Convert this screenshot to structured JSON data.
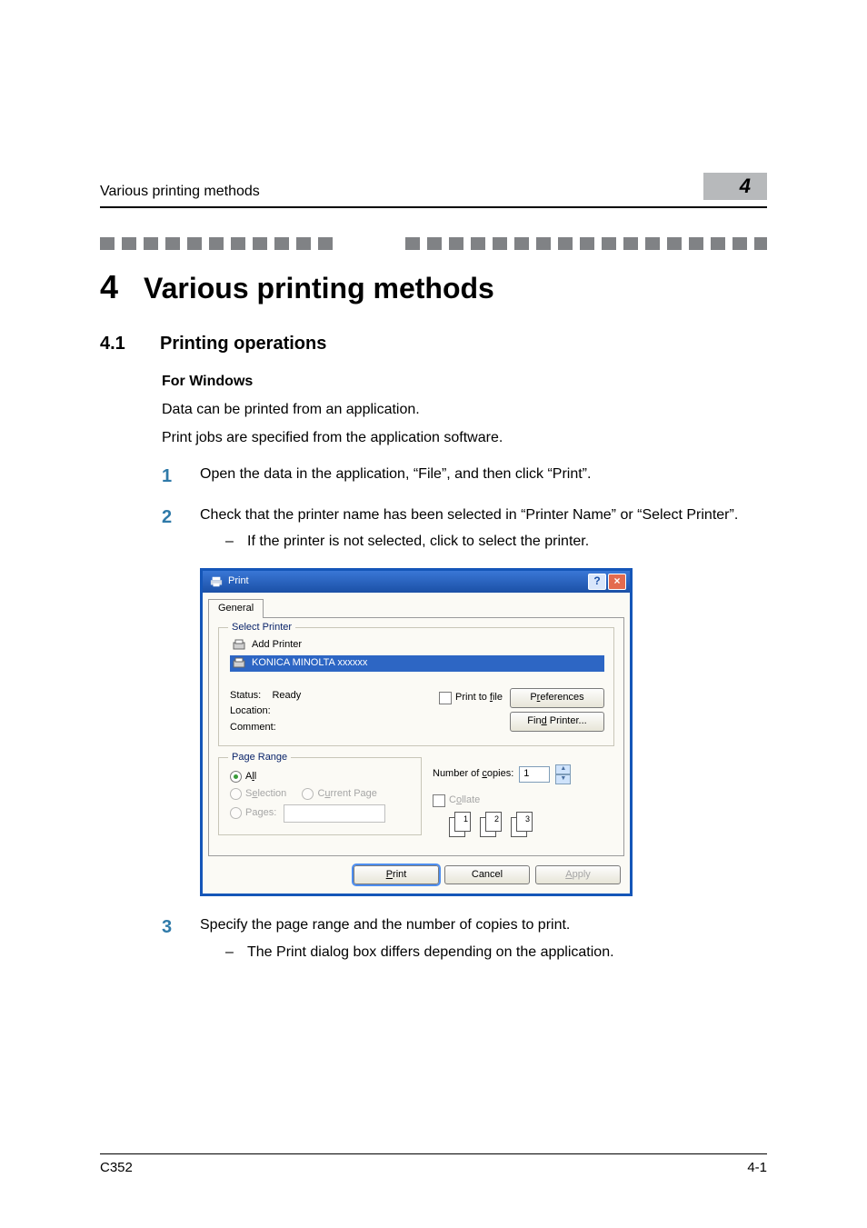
{
  "header": {
    "running": "Various printing methods",
    "badge": "4"
  },
  "chapter": {
    "number": "4",
    "title": "Various printing methods"
  },
  "section": {
    "number": "4.1",
    "title": "Printing operations"
  },
  "body": {
    "subhead": "For Windows",
    "para1": "Data can be printed from an application.",
    "para2": "Print jobs are specified from the application software.",
    "steps": [
      {
        "n": "1",
        "text": "Open the data in the application, “File”, and then click “Print”."
      },
      {
        "n": "2",
        "text": "Check that the printer name has been selected in “Printer Name” or “Select Printer”.",
        "sub": "If the printer is not selected, click to select the printer."
      },
      {
        "n": "3",
        "text": "Specify the page range and the number of copies to print.",
        "sub": "The Print dialog box differs depending on the application."
      }
    ]
  },
  "dialog": {
    "title": "Print",
    "tab": "General",
    "groups": {
      "select_printer": "Select Printer",
      "page_range": "Page Range"
    },
    "printers": {
      "add": "Add Printer",
      "selected": "KONICA MINOLTA xxxxxx"
    },
    "meta": {
      "status_lbl": "Status:",
      "status_val": "Ready",
      "location_lbl": "Location:",
      "comment_lbl": "Comment:"
    },
    "print_to_file": "Print to file",
    "buttons": {
      "preferences": "Preferences",
      "find_printer": "Find Printer...",
      "print": "Print",
      "cancel": "Cancel",
      "apply": "Apply"
    },
    "page_range": {
      "all": "All",
      "selection": "Selection",
      "current": "Current Page",
      "pages": "Pages:"
    },
    "copies": {
      "label": "Number of copies:",
      "value": "1",
      "collate": "Collate"
    },
    "collate_stacks": [
      [
        "1",
        "1"
      ],
      [
        "2",
        "2"
      ],
      [
        "3",
        "3"
      ]
    ]
  },
  "footer": {
    "left": "C352",
    "right": "4-1"
  }
}
